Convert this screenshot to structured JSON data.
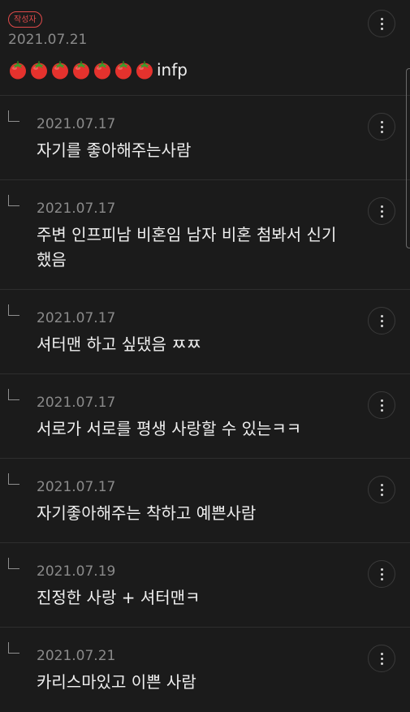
{
  "top_comment": {
    "badge": "작성자",
    "date": "2021.07.21",
    "tomato_icons": [
      "tomato-icon",
      "tomato-icon",
      "tomato-icon",
      "tomato-icon",
      "tomato-icon",
      "tomato-icon",
      "tomato-icon"
    ],
    "text": "infp"
  },
  "replies": [
    {
      "date": "2021.07.17",
      "text": "자기를 좋아해주는사람"
    },
    {
      "date": "2021.07.17",
      "text": "주변 인프피남 비혼임 남자 비혼 첨봐서 신기했음"
    },
    {
      "date": "2021.07.17",
      "text": "셔터맨 하고 싶댔음 ㅉㅉ"
    },
    {
      "date": "2021.07.17",
      "text": "서로가 서로를 평생 사랑할 수 있는ㅋㅋ"
    },
    {
      "date": "2021.07.17",
      "text": "자기좋아해주는 착하고 예쁜사람"
    },
    {
      "date": "2021.07.19",
      "text": "진정한 사랑 + 셔터맨ㅋ"
    },
    {
      "date": "2021.07.21",
      "text": "카리스마있고 이쁜 사람"
    }
  ],
  "colors": {
    "background": "#1b1b1b",
    "badge": "#e04a4a",
    "date": "#8a8a8a",
    "text": "#efefef"
  }
}
